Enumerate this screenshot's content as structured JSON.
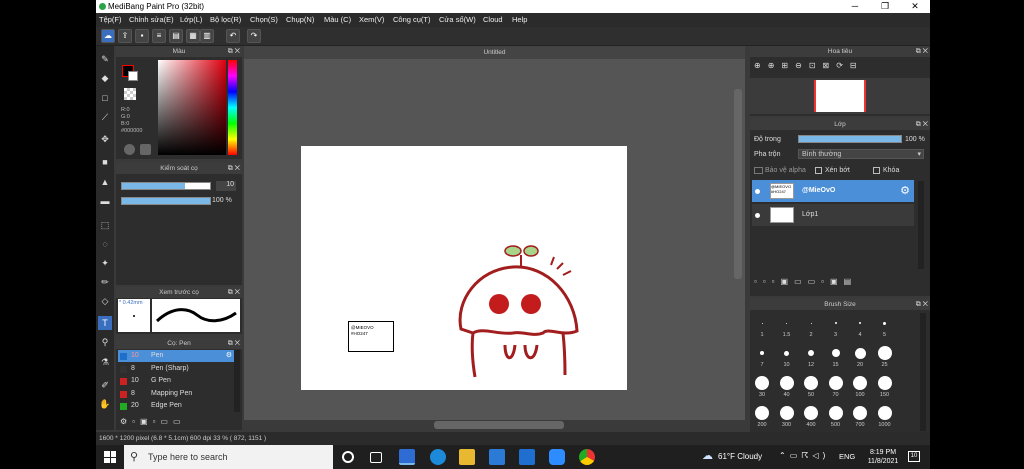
{
  "window": {
    "title": "MediBang Paint Pro (32bit)",
    "min": "─",
    "max": "❐",
    "close": "✕"
  },
  "menu": [
    "Tệp(F)",
    "Chỉnh sửa(E)",
    "Lớp(L)",
    "Bộ lọc(R)",
    "Chọn(S)",
    "Chụp(N)",
    "Màu (C)",
    "Xem(V)",
    "Công cụ(T)",
    "Cửa sổ(W)",
    "Cloud",
    "Help"
  ],
  "toolbar": {
    "undo": "↶",
    "redo": "↷"
  },
  "color_panel": {
    "title": "Màu",
    "r": "R:0",
    "g": "G:0",
    "b": "B:0",
    "hex": "#000000"
  },
  "brush_control": {
    "title": "Kiểm soát cọ",
    "size": "10",
    "opacity": "100 %",
    "size_level": 0.72,
    "opacity_level": 1.0
  },
  "brush_preview": {
    "title": "Xem trước cọ",
    "size_text": "* 0.42mm"
  },
  "brush_list": {
    "title": "Cọ: Pen",
    "items": [
      {
        "size": "10",
        "name": "Pen",
        "selected": true,
        "color": "#1e6fcc"
      },
      {
        "size": "8",
        "name": "Pen (Sharp)",
        "selected": false,
        "color": "#333333"
      },
      {
        "size": "10",
        "name": "G Pen",
        "selected": false,
        "color": "#cc2222"
      },
      {
        "size": "8",
        "name": "Mapping Pen",
        "selected": false,
        "color": "#cc2222"
      },
      {
        "size": "20",
        "name": "Edge Pen",
        "selected": false,
        "color": "#22aa22"
      }
    ]
  },
  "document": {
    "tab": "Untitled",
    "note_line1": "@MIEOVO",
    "note_line2": "#HO247"
  },
  "navigator": {
    "title": "Hoa tiêu"
  },
  "layer_panel": {
    "title": "Lớp",
    "opacity_label": "Độ trong",
    "opacity_value": "100 %",
    "opacity_level": 1.0,
    "blend_label": "Pha trộn",
    "blend_value": "Bình thường",
    "protect_alpha": "Bảo vệ alpha",
    "clipping": "Xén bớt",
    "lock": "Khóa",
    "layers": [
      {
        "name": "@MieOvO",
        "thumb": "@MIEOVO #HO247",
        "selected": true
      },
      {
        "name": "Lớp1",
        "selected": false
      }
    ]
  },
  "brush_size": {
    "title": "Brush Size",
    "rows": [
      [
        "1",
        "1.5",
        "2",
        "3",
        "4",
        "5"
      ],
      [
        "7",
        "10",
        "12",
        "15",
        "20",
        "25"
      ],
      [
        "30",
        "40",
        "50",
        "70",
        "100",
        "150"
      ],
      [
        "200",
        "300",
        "400",
        "500",
        "700",
        "1000"
      ]
    ]
  },
  "status": {
    "text": "1600 * 1200 pixel  (6.8 * 5.1cm)  600 dpi  33 %  ( 872, 1151 )"
  },
  "taskbar": {
    "search_placeholder": "Type here to search",
    "weather": "61°F  Cloudy",
    "lang": "ENG",
    "time": "8:19 PM",
    "date": "11/8/2021",
    "notif": "10"
  }
}
